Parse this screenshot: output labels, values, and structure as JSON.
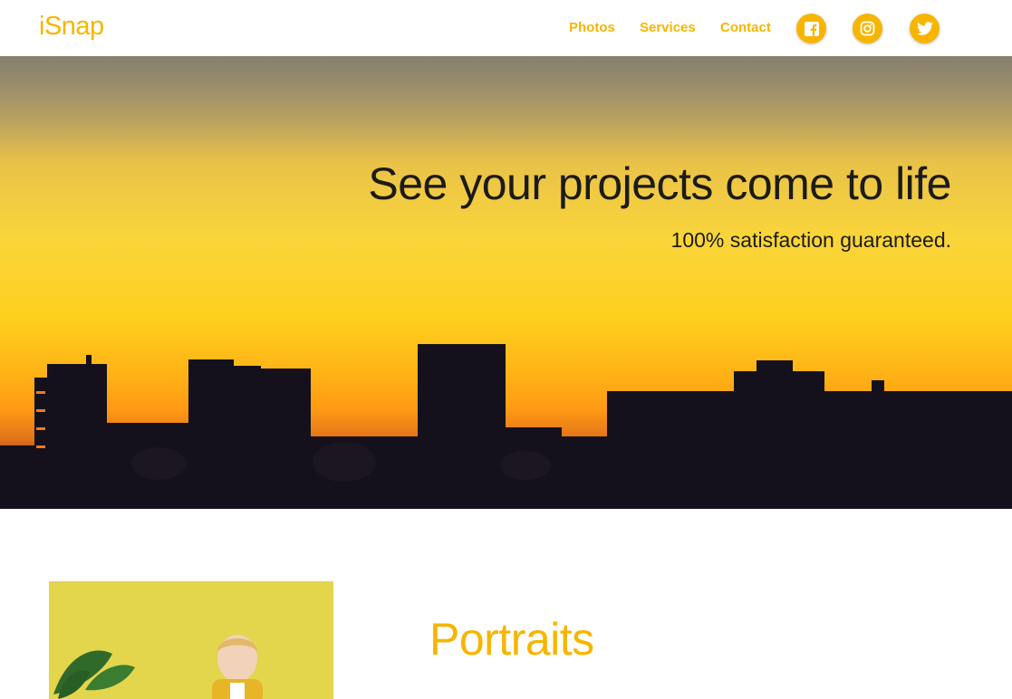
{
  "brand": {
    "logo": "iSnap",
    "accent_color": "#f7b500"
  },
  "nav": {
    "links": [
      {
        "label": "Photos"
      },
      {
        "label": "Services"
      },
      {
        "label": "Contact"
      }
    ],
    "social": [
      {
        "icon": "facebook-icon"
      },
      {
        "icon": "instagram-icon"
      },
      {
        "icon": "twitter-icon"
      }
    ]
  },
  "hero": {
    "title": "See your projects come to life",
    "subtitle": "100% satisfaction guaranteed."
  },
  "portraits": {
    "heading": "Portraits"
  }
}
